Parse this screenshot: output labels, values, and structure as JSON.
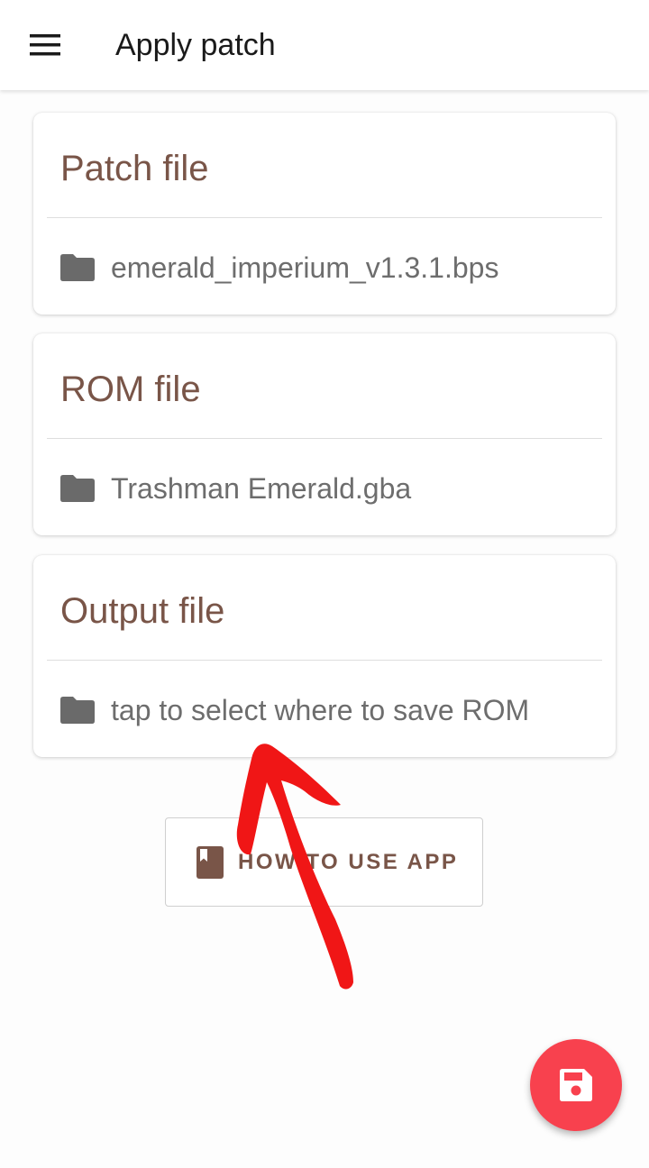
{
  "appbar": {
    "title": "Apply patch",
    "menu_icon": "hamburger-menu-icon"
  },
  "cards": [
    {
      "title": "Patch file",
      "value": "emerald_imperium_v1.3.1.bps",
      "icon": "folder-icon"
    },
    {
      "title": "ROM file",
      "value": "Trashman Emerald.gba",
      "icon": "folder-icon"
    },
    {
      "title": "Output file",
      "value": "tap to select where to save ROM",
      "icon": "folder-icon"
    }
  ],
  "howto_button": {
    "label": "HOW TO USE APP",
    "icon": "book-icon"
  },
  "fab": {
    "icon": "save-icon"
  },
  "colors": {
    "accent_brown": "#795548",
    "fab_red": "#f8414e",
    "annotation_red": "#f01616",
    "folder_gray": "#6a6a6a"
  }
}
